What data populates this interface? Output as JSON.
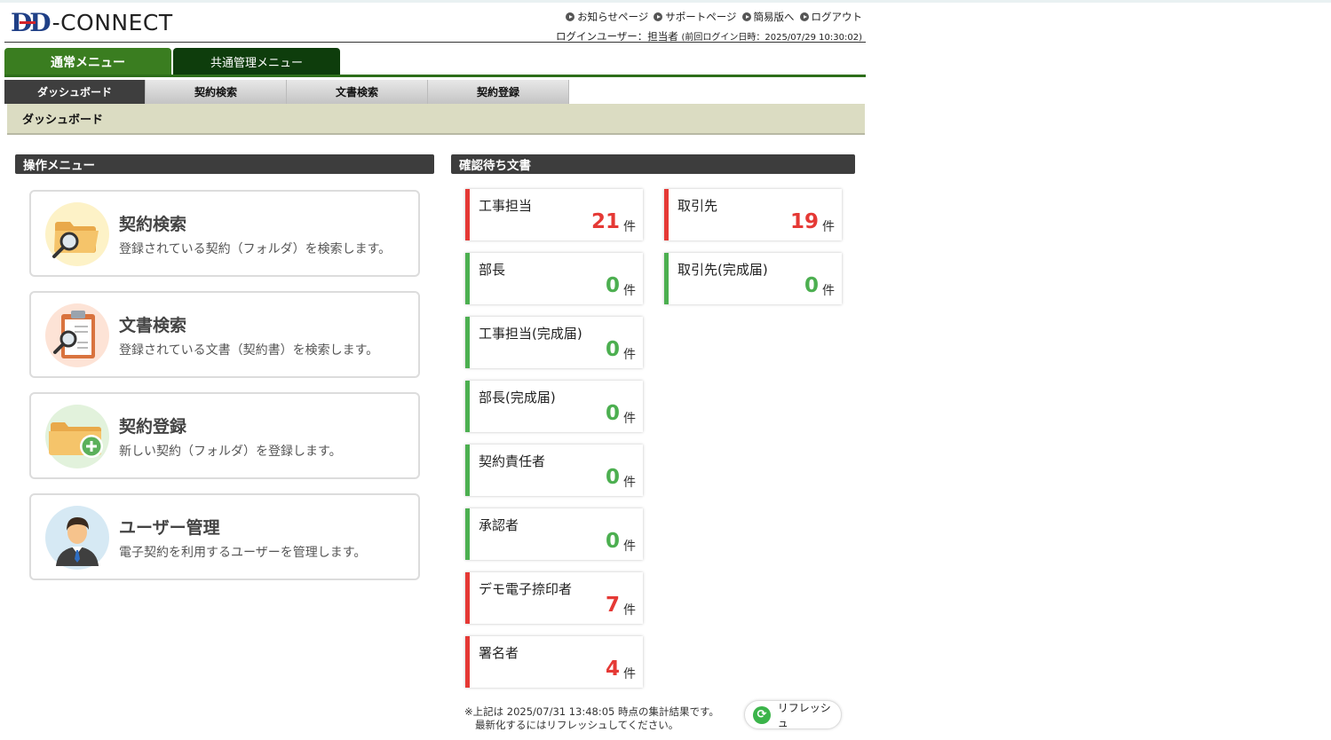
{
  "header": {
    "logo": {
      "part1": "D",
      "part2": "D",
      "brand": "-CONNECT"
    },
    "links": [
      "お知らせページ",
      "サポートページ",
      "簡易版へ",
      "ログアウト"
    ],
    "user_label": "ログインユーザー：担当者",
    "last_login": "(前回ログイン日時：2025/07/29 10:30:02)"
  },
  "main_tabs": [
    {
      "label": "通常メニュー"
    },
    {
      "label": "共通管理メニュー"
    }
  ],
  "sub_tabs": [
    {
      "label": "ダッシュボード"
    },
    {
      "label": "契約検索"
    },
    {
      "label": "文書検索"
    },
    {
      "label": "契約登録"
    }
  ],
  "breadcrumb": "ダッシュボード",
  "operation_menu": {
    "title": "操作メニュー",
    "items": [
      {
        "title": "契約検索",
        "desc": "登録されている契約（フォルダ）を検索します。",
        "icon": "folder-search-icon"
      },
      {
        "title": "文書検索",
        "desc": "登録されている文書（契約書）を検索します。",
        "icon": "clipboard-search-icon"
      },
      {
        "title": "契約登録",
        "desc": "新しい契約（フォルダ）を登録します。",
        "icon": "folder-add-icon"
      },
      {
        "title": "ユーザー管理",
        "desc": "電子契約を利用するユーザーを管理します。",
        "icon": "user-icon"
      }
    ]
  },
  "pending": {
    "title": "確認待ち文書",
    "unit": "件",
    "left": [
      {
        "label": "工事担当",
        "count": "21",
        "status": "red"
      },
      {
        "label": "部長",
        "count": "0",
        "status": "green"
      },
      {
        "label": "工事担当(完成届)",
        "count": "0",
        "status": "green"
      },
      {
        "label": "部長(完成届)",
        "count": "0",
        "status": "green"
      },
      {
        "label": "契約責任者",
        "count": "0",
        "status": "green"
      },
      {
        "label": "承認者",
        "count": "0",
        "status": "green"
      },
      {
        "label": "デモ電子捺印者",
        "count": "7",
        "status": "red"
      },
      {
        "label": "署名者",
        "count": "4",
        "status": "red"
      }
    ],
    "right": [
      {
        "label": "取引先",
        "count": "19",
        "status": "red"
      },
      {
        "label": "取引先(完成届)",
        "count": "0",
        "status": "green"
      }
    ],
    "note_line1": "※上記は 2025/07/31 13:48:05 時点の集計結果です。",
    "note_line2": "最新化するにはリフレッシュしてください。",
    "refresh_label": "リフレッシュ"
  },
  "colors": {
    "accent_green": "#3a7d20",
    "dark_green": "#0e3d0c",
    "count_red": "#e53935",
    "count_green": "#4caf50"
  }
}
